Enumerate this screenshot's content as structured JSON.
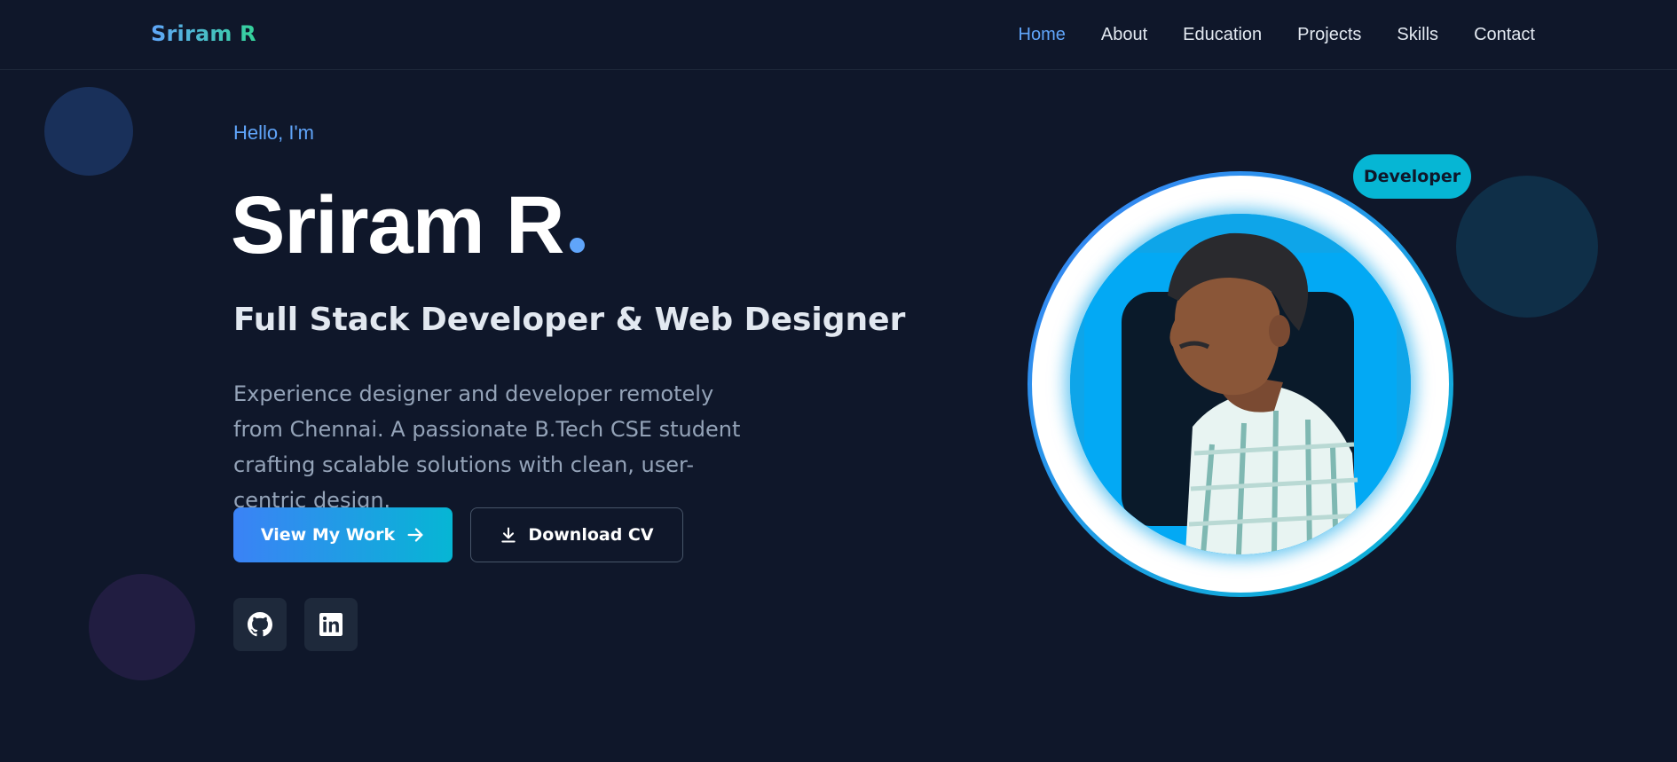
{
  "nav": {
    "logo": "Sriram R",
    "links": [
      {
        "label": "Home",
        "active": true
      },
      {
        "label": "About",
        "active": false
      },
      {
        "label": "Education",
        "active": false
      },
      {
        "label": "Projects",
        "active": false
      },
      {
        "label": "Skills",
        "active": false
      },
      {
        "label": "Contact",
        "active": false
      }
    ]
  },
  "hero": {
    "greeting": "Hello, I'm",
    "name": "Sriram R",
    "role": "Full Stack Developer & Web Designer",
    "description": "Experience designer and developer remotely from Chennai. A passionate B.Tech CSE student crafting scalable solutions with clean, user-centric design.",
    "primary_button": "View My Work",
    "secondary_button": "Download CV",
    "social": [
      {
        "icon": "github-icon"
      },
      {
        "icon": "linkedin-icon"
      }
    ]
  },
  "profile": {
    "badge": "Developer"
  },
  "colors": {
    "background": "#0f172a",
    "accent_blue": "#60a5fa",
    "accent_cyan": "#06b6d4",
    "accent_green": "#34d399"
  }
}
